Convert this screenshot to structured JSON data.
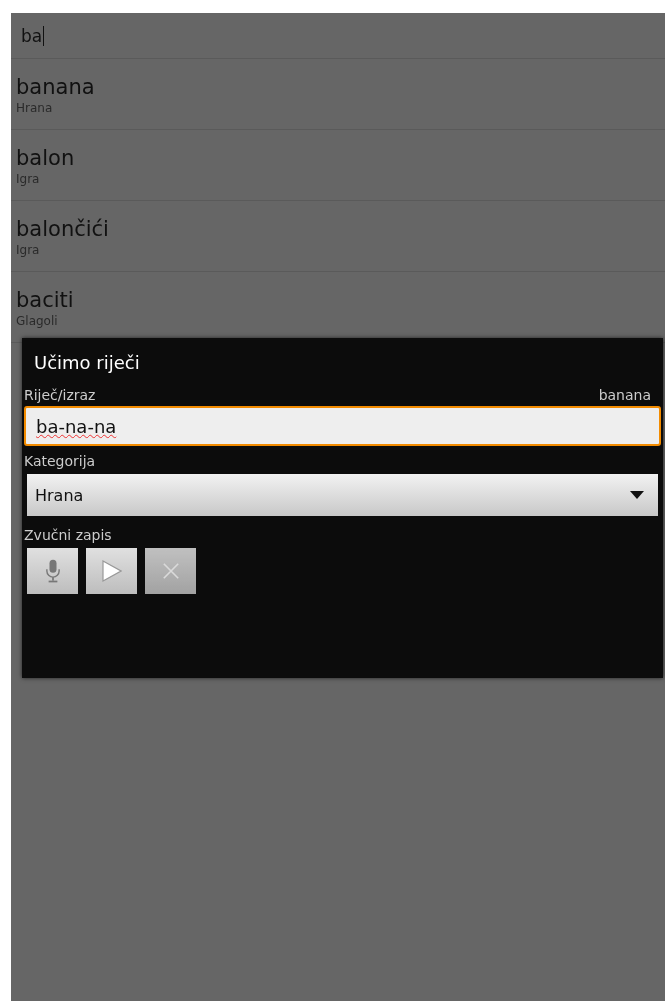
{
  "search": {
    "value": "ba"
  },
  "results": [
    {
      "word": "banana",
      "category": "Hrana"
    },
    {
      "word": "balon",
      "category": "Igra"
    },
    {
      "word": "balončići",
      "category": "Igra"
    },
    {
      "word": "baciti",
      "category": "Glagoli"
    }
  ],
  "dialog": {
    "title": "Učimo riječi",
    "word_label": "Riječ/izraz",
    "word_hint": "banana",
    "word_value": "ba-na-na",
    "misspelled": true,
    "category_label": "Kategorija",
    "category_value": "Hrana",
    "sound_label": "Zvučni zapis",
    "sound_buttons": [
      {
        "kind": "record",
        "disabled": false
      },
      {
        "kind": "play",
        "disabled": false
      },
      {
        "kind": "delete",
        "disabled": true
      }
    ]
  }
}
